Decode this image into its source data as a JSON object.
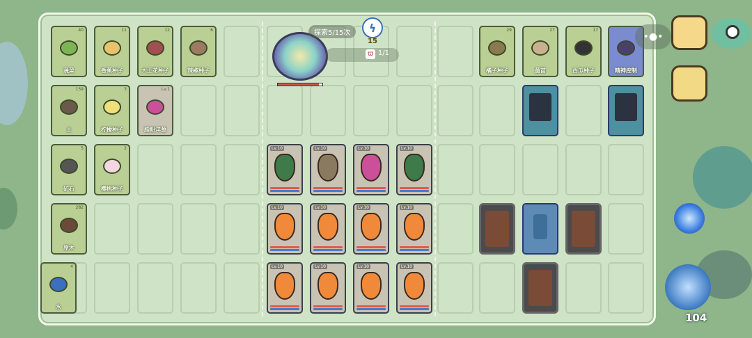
{
  "explore": {
    "label": "探索5/15次",
    "energy": "15",
    "pet_count": "1/1"
  },
  "resources": [
    {
      "id": "veg",
      "label": "蔬菜",
      "count": "40"
    },
    {
      "id": "banana-seed",
      "label": "香蕉种子",
      "count": "11"
    },
    {
      "id": "rafflesia-seed",
      "label": "大王花种子",
      "count": "12"
    },
    {
      "id": "pepper-seed",
      "label": "辣椒种子",
      "count": "6"
    },
    {
      "id": "orange-seed",
      "label": "橘子种子",
      "count": "29"
    },
    {
      "id": "seedling",
      "label": "菌苗",
      "count": "27"
    },
    {
      "id": "melon-seed",
      "label": "西瓜种子",
      "count": "17"
    },
    {
      "id": "spirit",
      "label": "精神控制",
      "count": ""
    },
    {
      "id": "soil",
      "label": "土",
      "count": "159"
    },
    {
      "id": "lemon-seed",
      "label": "柠檬种子",
      "count": "3"
    },
    {
      "id": "onion",
      "label": "脂粉洋葱",
      "count": "Lv.1"
    },
    {
      "id": "ore",
      "label": "矿石",
      "count": "5"
    },
    {
      "id": "cherry-seed",
      "label": "樱桃种子",
      "count": "2"
    },
    {
      "id": "wood",
      "label": "原木",
      "count": "282"
    },
    {
      "id": "water",
      "label": "水",
      "count": "4"
    }
  ],
  "units": {
    "row1": [
      "Lv.10",
      "Lv.10",
      "Lv.10",
      "Lv.10"
    ],
    "row2": [
      "Lv.10",
      "Lv.10",
      "Lv.10",
      "Lv.10"
    ],
    "row3": [
      "Lv.10",
      "Lv.10",
      "Lv.10",
      "Lv.10"
    ]
  },
  "battle_power": "104",
  "icons": [
    "energy-icon",
    "pet-icon",
    "menu-icon",
    "eye-icon",
    "lock-icon",
    "compass-icon",
    "battle-icon"
  ]
}
